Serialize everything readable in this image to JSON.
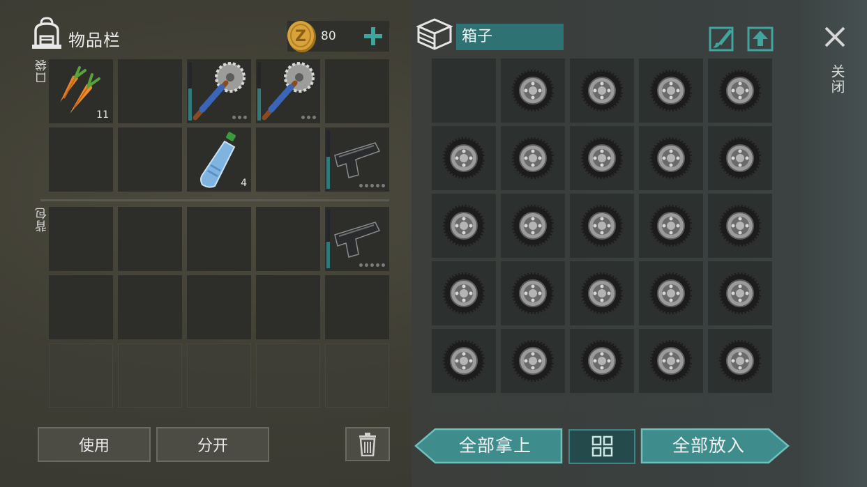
{
  "inventory": {
    "title": "物品栏",
    "coins": "80",
    "pocket_label": "口袋",
    "backpack_label": "背包",
    "pocket_items": [
      {
        "name": "carrot",
        "count": "11",
        "col": 0,
        "row": 0
      },
      {
        "name": "saw-mace",
        "durability": 0.55,
        "col": 2,
        "row": 0
      },
      {
        "name": "saw-mace",
        "durability": 0.55,
        "col": 3,
        "row": 0
      },
      {
        "name": "water-bottle",
        "count": "4",
        "col": 2,
        "row": 1
      },
      {
        "name": "pistol",
        "durability": 0.55,
        "col": 4,
        "row": 1
      }
    ],
    "backpack_items": [
      {
        "name": "pistol",
        "durability": 0.45,
        "col": 4,
        "row": 0
      }
    ]
  },
  "actions": {
    "use_label": "使用",
    "split_label": "分开"
  },
  "container": {
    "name_value": "箱子",
    "close_label": "关闭",
    "take_all_label": "全部拿上",
    "put_all_label": "全部放入",
    "item_name": "tire",
    "filled_slots": 24,
    "empty_slots": [
      0
    ]
  },
  "icons": {
    "backpack": "backpack-icon",
    "coin": "coin-icon",
    "plus": "plus-icon",
    "box": "box-icon",
    "paint": "paint-brush-icon",
    "upload": "upload-icon",
    "close": "close-icon",
    "trash": "trash-icon",
    "sort": "grid-icon"
  },
  "colors": {
    "accent_teal": "#2f7273",
    "button_teal": "#3e8c8b",
    "plus_green": "#3fa59d",
    "slot_dark": "#2d2e2a"
  }
}
